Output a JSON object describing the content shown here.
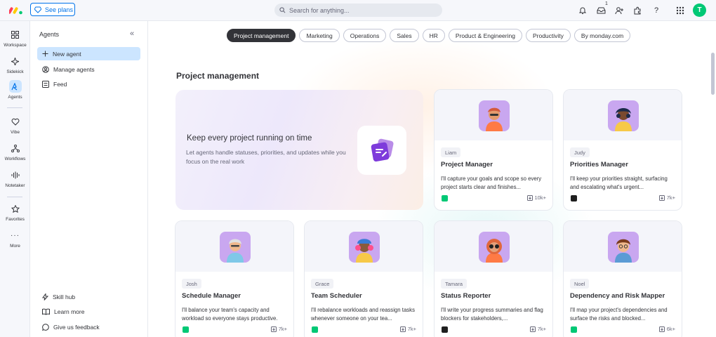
{
  "topbar": {
    "see_plans": "See plans",
    "search_placeholder": "Search for anything...",
    "inbox_badge": "1",
    "avatar_initial": "T",
    "avatar_color": "#00c875",
    "accent_color": "#0073ea",
    "icons": [
      "bell-icon",
      "inbox-icon",
      "invite-user-icon",
      "integrations-icon",
      "help-icon",
      "apps-grid-icon"
    ]
  },
  "rail": {
    "items": [
      {
        "label": "Workspace",
        "icon": "workspace-icon"
      },
      {
        "label": "Sidekick",
        "icon": "sidekick-icon"
      },
      {
        "label": "Agents",
        "icon": "agents-icon",
        "active": true
      },
      {
        "label": "Vibe",
        "icon": "vibe-icon"
      },
      {
        "label": "Workflows",
        "icon": "workflows-icon"
      },
      {
        "label": "Notetaker",
        "icon": "notetaker-icon"
      },
      {
        "label": "Favorites",
        "icon": "star-icon"
      },
      {
        "label": "More",
        "icon": "more-icon"
      }
    ]
  },
  "panel": {
    "title": "Agents",
    "items": [
      {
        "label": "New agent",
        "icon": "plus-icon",
        "active": true
      },
      {
        "label": "Manage agents",
        "icon": "user-circle-icon"
      },
      {
        "label": "Feed",
        "icon": "feed-icon"
      }
    ],
    "footer": [
      {
        "label": "Skill hub",
        "icon": "bolt-icon"
      },
      {
        "label": "Learn more",
        "icon": "book-icon"
      },
      {
        "label": "Give us feedback",
        "icon": "feedback-icon"
      }
    ]
  },
  "tabs": [
    "Project management",
    "Marketing",
    "Operations",
    "Sales",
    "HR",
    "Product & Engineering",
    "Productivity",
    "By monday.com"
  ],
  "active_tab": "Project management",
  "section_title": "Project management",
  "hero": {
    "title": "Keep every project running on time",
    "subtitle": "Let agents handle statuses, priorities, and updates while you focus on the real work",
    "icon": "task-cards-icon",
    "icon_color": "#7e3bdb"
  },
  "cards": [
    {
      "person": "Liam",
      "title": "Project Manager",
      "desc": "I'll capture your goals and scope so every project starts clear and finishes...",
      "count": "10k+",
      "app_color": "#00c875",
      "bg": "#c9a7f0"
    },
    {
      "person": "Judy",
      "title": "Priorities Manager",
      "desc": "I'll keep your priorities straight, surfacing and escalating what's urgent...",
      "count": "7k+",
      "app_color": "#1f1f1f",
      "bg": "#c9a7f0"
    },
    {
      "person": "Josh",
      "title": "Schedule Manager",
      "desc": "I'll balance your team's capacity and workload so everyone stays productive.",
      "count": "7k+",
      "app_color": "#00c875",
      "bg": "#c9a7f0"
    },
    {
      "person": "Grace",
      "title": "Team Scheduler",
      "desc": "I'll rebalance workloads and reassign tasks whenever someone on your tea...",
      "count": "7k+",
      "app_color": "#00c875",
      "bg": "#c9a7f0"
    },
    {
      "person": "Tamara",
      "title": "Status Reporter",
      "desc": "I'll write your progress summaries and flag blockers for stakeholders,...",
      "count": "7k+",
      "app_color": "#1f1f1f",
      "bg": "#c9a7f0"
    },
    {
      "person": "Noel",
      "title": "Dependency and Risk Mapper",
      "desc": "I'll map your project's dependencies and surface the risks and blocked...",
      "count": "6k+",
      "app_color": "#00c875",
      "bg": "#c9a7f0"
    }
  ]
}
